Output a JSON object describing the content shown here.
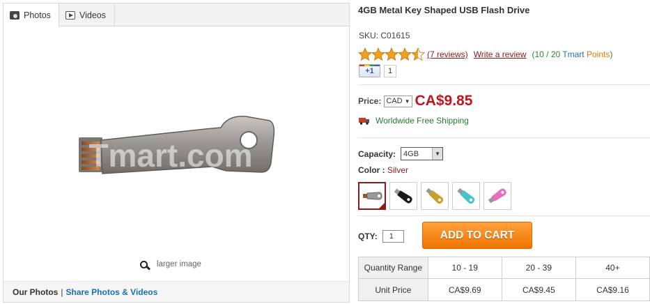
{
  "gallery": {
    "tabs": [
      {
        "label": "Photos",
        "icon": "camera-icon"
      },
      {
        "label": "Videos",
        "icon": "play-icon"
      }
    ],
    "watermark": "Tmart.com",
    "larger_image": "larger image",
    "our_photos": "Our Photos",
    "separator": "|",
    "share": "Share Photos & Videos"
  },
  "product": {
    "title": "4GB Metal Key Shaped USB Flash Drive",
    "sku": "SKU: C01615",
    "rating": 4.5,
    "reviews_link": "(7 reviews)",
    "write_review": "Write a review",
    "points_open": "(10 / 20",
    "points_tmart": "Tmart",
    "points_word": "Points",
    "points_close": ")",
    "gplus_label": "+1",
    "gplus_count": "1",
    "price_label": "Price:",
    "currency": "CAD",
    "price": "CA$9.85",
    "shipping": "Worldwide Free Shipping",
    "capacity_label": "Capacity:",
    "capacity_value": "4GB",
    "color_label": "Color :",
    "color_value": "Silver",
    "swatches": [
      {
        "name": "Silver",
        "color": "#9a9a9a"
      },
      {
        "name": "Black",
        "color": "#1a1a1a"
      },
      {
        "name": "Gold",
        "color": "#c8a030"
      },
      {
        "name": "Blue",
        "color": "#4ec0cc"
      },
      {
        "name": "Pink",
        "color": "#e66ec0"
      }
    ],
    "qty_label": "QTY:",
    "qty_value": "1",
    "add_to_cart": "ADD TO CART"
  },
  "pricing_table": {
    "row1_header": "Quantity Range",
    "ranges": [
      "10 - 19",
      "20 - 39",
      "40+"
    ],
    "row2_header": "Unit Price",
    "prices": [
      "CA$9.69",
      "CA$9.45",
      "CA$9.16"
    ]
  },
  "colors": {
    "price_red": "#c0161b",
    "link_maroon": "#8b1a1a",
    "shipping_green": "#2a7a2a",
    "button_orange": "#f07300",
    "share_blue": "#1a6fb5"
  }
}
